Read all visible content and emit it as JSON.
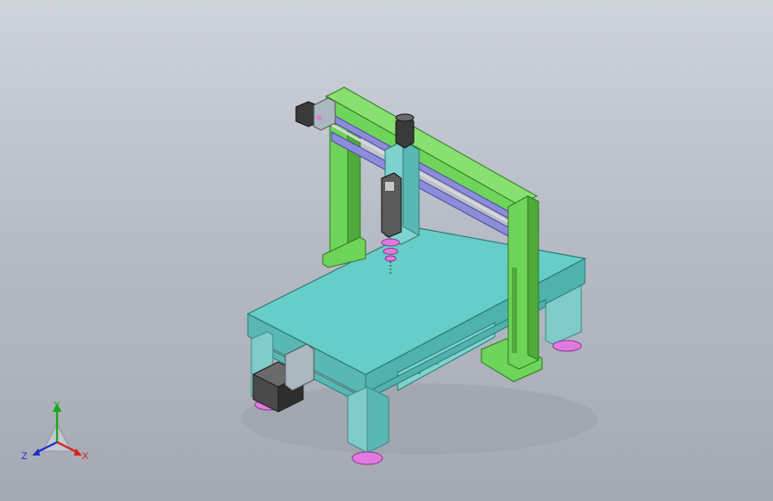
{
  "viewport": {
    "background_top": "#cfd3db",
    "background_bottom": "#a4a9b3"
  },
  "model": {
    "table_top_color": "#66cdc8",
    "table_edge_color": "#4fb2ad",
    "leg_color": "#7ecbc8",
    "gantry_color": "#6fd45a",
    "gantry_dark_color": "#4faa3c",
    "rail_color": "#8c8cd8",
    "motor_color": "#3a3a3a",
    "foot_color": "#e07ae0"
  },
  "triad": {
    "x_label": "X",
    "y_label": "Y",
    "z_label": "Z",
    "x_color": "#d42020",
    "y_color": "#18a818",
    "z_color": "#2030c8"
  }
}
